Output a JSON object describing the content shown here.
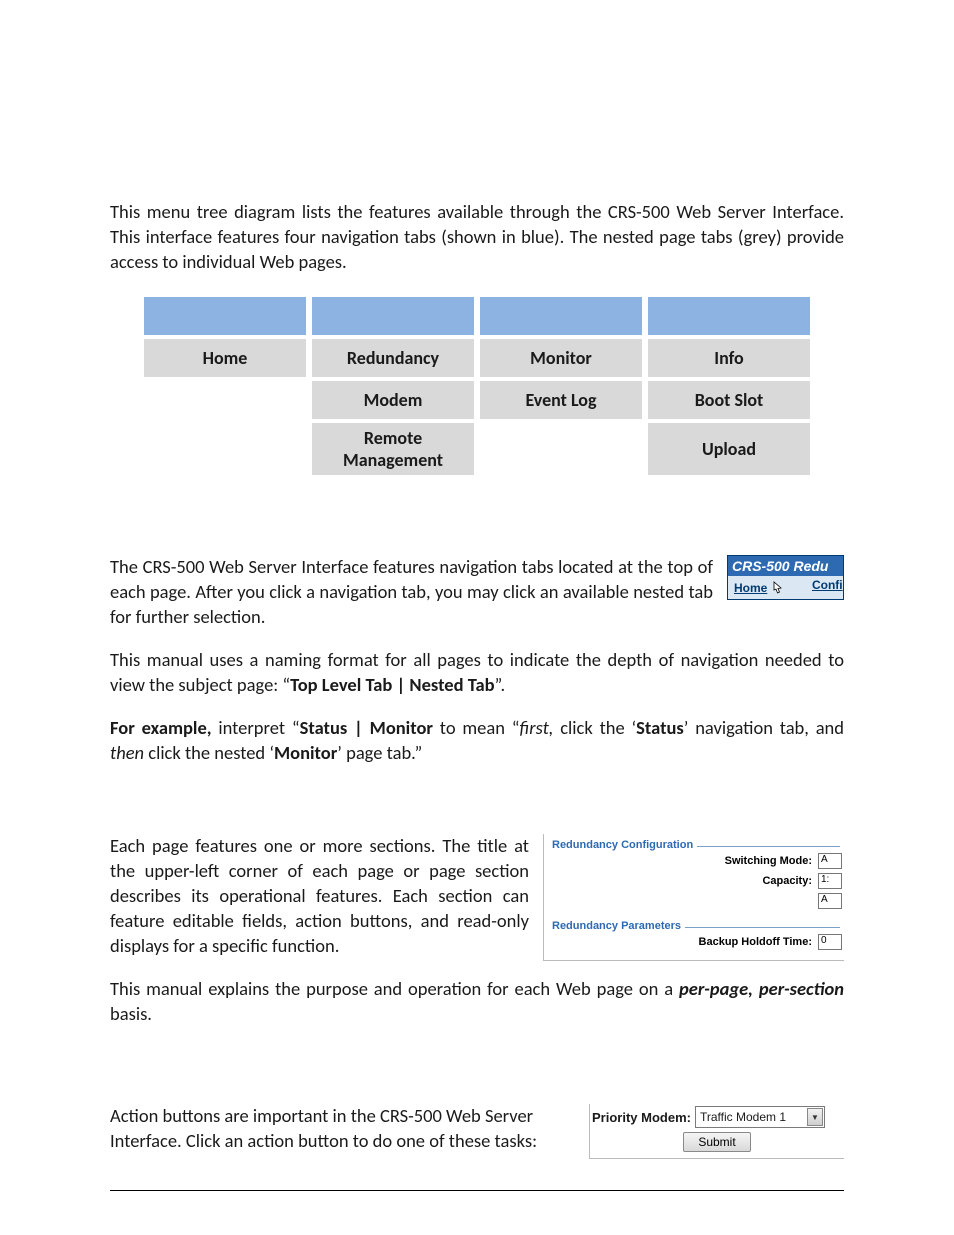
{
  "intro": {
    "p1": "This menu tree diagram lists the features available through the CRS-500 Web Server Interface. This interface features four navigation tabs (shown in blue). The nested page tabs (grey) provide access to individual Web pages."
  },
  "menu": {
    "row2": [
      "Home",
      "Redundancy",
      "Monitor",
      "Info"
    ],
    "row3": [
      "",
      "Modem",
      "Event Log",
      "Boot Slot"
    ],
    "row4": [
      "",
      "Remote Management",
      "",
      "Upload"
    ]
  },
  "nav": {
    "p1": "The CRS-500 Web Server Interface features navigation tabs located at the top of each page. After you click a navigation tab, you may click an available nested tab for further selection.",
    "inset_title": "CRS-500 Redu",
    "inset_link1": "Home",
    "inset_link2": "Confi",
    "p2a": "This manual uses a naming format for all pages to indicate the depth of navigation needed to view the subject page: “",
    "p2b": "Top Level Tab | Nested Tab",
    "p2c": "”.",
    "p3_a": "For example,",
    "p3_b": " interpret “",
    "p3_c": "Status | Monitor",
    "p3_d": " to mean “",
    "p3_e": "first,",
    "p3_f": " click the ‘",
    "p3_g": "Status",
    "p3_h": "’ navigation tab, and ",
    "p3_i": "then",
    "p3_j": " click the nested ‘",
    "p3_k": "Monitor",
    "p3_l": "’ page tab.”"
  },
  "sections": {
    "p1": "Each page features one or more sections. The title at the upper-left corner of each page or page section describes its operational features. Each section can feature editable fields, action buttons, and read-only displays for a specific function.",
    "p2a": "This manual explains the purpose and operation for each Web page on a ",
    "p2b": "per-page, per-section",
    "p2c": " basis."
  },
  "redcfg": {
    "legend1": "Redundancy Configuration",
    "row1_label": "Switching Mode:",
    "row1_value": "A",
    "row2_label": "Capacity:",
    "row2_value": "1:",
    "row2b_value": "A",
    "legend2": "Redundancy Parameters",
    "row3_label": "Backup Holdoff Time:",
    "row3_value": "0"
  },
  "action": {
    "p1": "Action buttons are important in the CRS-500 Web Server Interface. Click an action button to do one of these tasks:"
  },
  "pm": {
    "label": "Priority Modem:",
    "selected": "Traffic Modem 1",
    "submit": "Submit"
  }
}
